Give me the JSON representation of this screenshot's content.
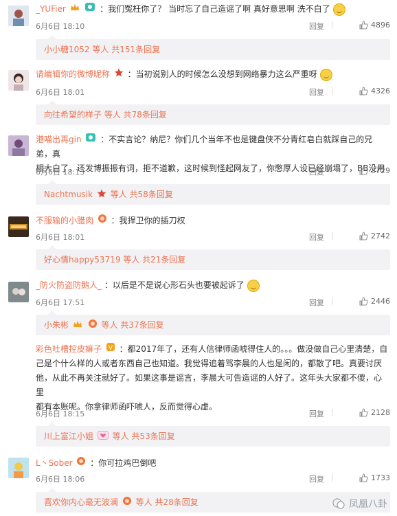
{
  "comments": [
    {
      "username": "_YUFier",
      "text": "：我们冤枉你了？ 当时忘了自己造谣了啊 真好意思啊 洗不白了",
      "date": "6月6日 18:10",
      "reply": "回复",
      "likes": "4896",
      "replies": {
        "name": "小小糖1052",
        "suffix": "等人 共151条回复"
      }
    },
    {
      "username": "请编辑你的微博昵称",
      "text": "：当初说别人的时候怎么没想到网络暴力这么严重呀",
      "date": "6月6日 18:01",
      "reply": "回复",
      "likes": "4326",
      "replies": {
        "name": "向往希望的样子",
        "suffix": "等人 共78条回复"
      }
    },
    {
      "username": "港喵出再gin",
      "text_line1": "：不实言论？纳尼？你们几个当年不也是键盘侠不分青红皂白就踩自己的兄弟，真",
      "text_line2": "相大白了，还发博振振有词，拒不道歉，这时候到怪起网友了，你憋厚人设已经崩塌了，BB没用",
      "date": "6月6日 18:13",
      "reply": "回复",
      "likes": "3729",
      "replies": {
        "name": "Nachtmusik",
        "suffix": "等人 共58条回复"
      }
    },
    {
      "username": "不服输的小腊肉",
      "text": "：我捍卫你的插刀权",
      "date": "6月6日 18:01",
      "reply": "回复",
      "likes": "2742",
      "replies": {
        "name": "好心情happy53719",
        "suffix": "等人 共21条回复"
      }
    },
    {
      "username": "_防火防盗防鹅人_",
      "text": "：以后是不是说心形石头也要被起诉了",
      "date": "6月6日 17:51",
      "reply": "回复",
      "likes": "2446",
      "replies": {
        "name": "小朱彬",
        "suffix": "等人 共37条回复"
      }
    },
    {
      "username": "彩色吐槽控皮嫲子",
      "text_line1": "：都2017年了，还有人信律师函唬得住人的。。。做没做自己心里清楚，自",
      "text_line2": "己是个什么样的人或者东西自己也知道。我觉得追着骂李晨的人也是闲的，都散了吧。真要讨厌",
      "text_line3": "他，从此不再关注就好了。如果这事是谣言，李晨大可告造谣的人好了。这年头大家都不傻，心里",
      "text_line4": "都有本账呢。你拿律师函吓唬人，反而觉得心虚。",
      "date": "6月6日 18:15",
      "reply": "回复",
      "likes": "2128",
      "replies": {
        "name": "川上富江小姐",
        "suffix": "等人 共53条回复"
      }
    },
    {
      "username": "L丶Sober",
      "text": "：你可拉鸡巴倒吧",
      "date": "6月6日 18:06",
      "reply": "回复",
      "likes": "1733",
      "replies": {
        "name": "喜欢你内心毫无波澜",
        "suffix": "等人 共28条回复"
      }
    }
  ],
  "watermark": "凤凰八卦",
  "icons": {
    "like": "thumbs-up-icon",
    "watermark": "wechat-logo-icon"
  },
  "colors": {
    "link": "#eb7350",
    "meta": "#808080",
    "sub_bg": "#f2f2f5"
  }
}
